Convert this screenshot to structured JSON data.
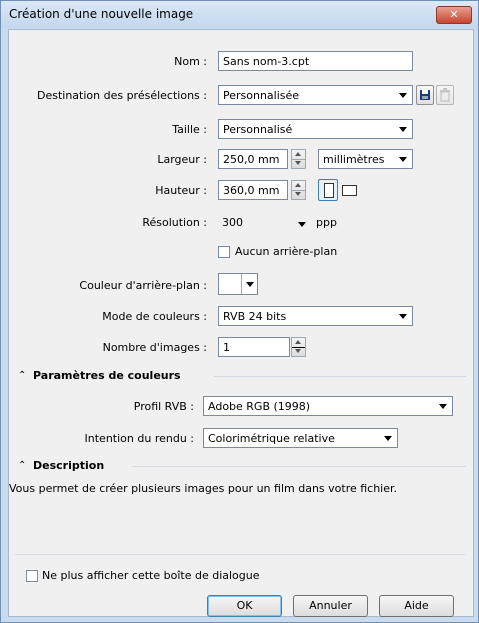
{
  "window": {
    "title": "Création d'une nouvelle image",
    "close_label": "✕"
  },
  "form": {
    "nom_label": "Nom :",
    "nom_value": "Sans nom-3.cpt",
    "destination_label": "Destination des présélections :",
    "destination_value": "Personnalisée",
    "taille_label": "Taille :",
    "taille_value": "Personnalisé",
    "largeur_label": "Largeur :",
    "largeur_value": "250,0 mm",
    "unit_value": "millimètres",
    "hauteur_label": "Hauteur :",
    "hauteur_value": "360,0 mm",
    "resolution_label": "Résolution :",
    "resolution_value": "300",
    "resolution_unit": "ppp",
    "no_background_label": "Aucun arrière-plan",
    "bg_color_label": "Couleur d'arrière-plan :",
    "color_mode_label": "Mode de couleurs :",
    "color_mode_value": "RVB 24 bits",
    "image_count_label": "Nombre d'images :",
    "image_count_value": "1"
  },
  "color_settings": {
    "heading": "Paramètres de couleurs",
    "rgb_profile_label": "Profil RVB :",
    "rgb_profile_value": "Adobe RGB (1998)",
    "intent_label": "Intention du rendu :",
    "intent_value": "Colorimétrique relative"
  },
  "description": {
    "heading": "Description",
    "text": "Vous permet de créer plusieurs images pour un film dans votre fichier."
  },
  "footer": {
    "dont_show_label": "Ne plus afficher cette boîte de dialogue",
    "ok_label": "OK",
    "cancel_label": "Annuler",
    "help_label": "Aide"
  },
  "icons": {
    "save": "save-preset-icon",
    "delete": "delete-preset-icon",
    "portrait": "portrait-orientation-icon",
    "landscape": "landscape-orientation-icon",
    "collapse": "collapse-chevron-icon"
  },
  "colors": {
    "accent": "#3c7fb1",
    "close": "#c8452f",
    "frame": "#c9dcef"
  }
}
